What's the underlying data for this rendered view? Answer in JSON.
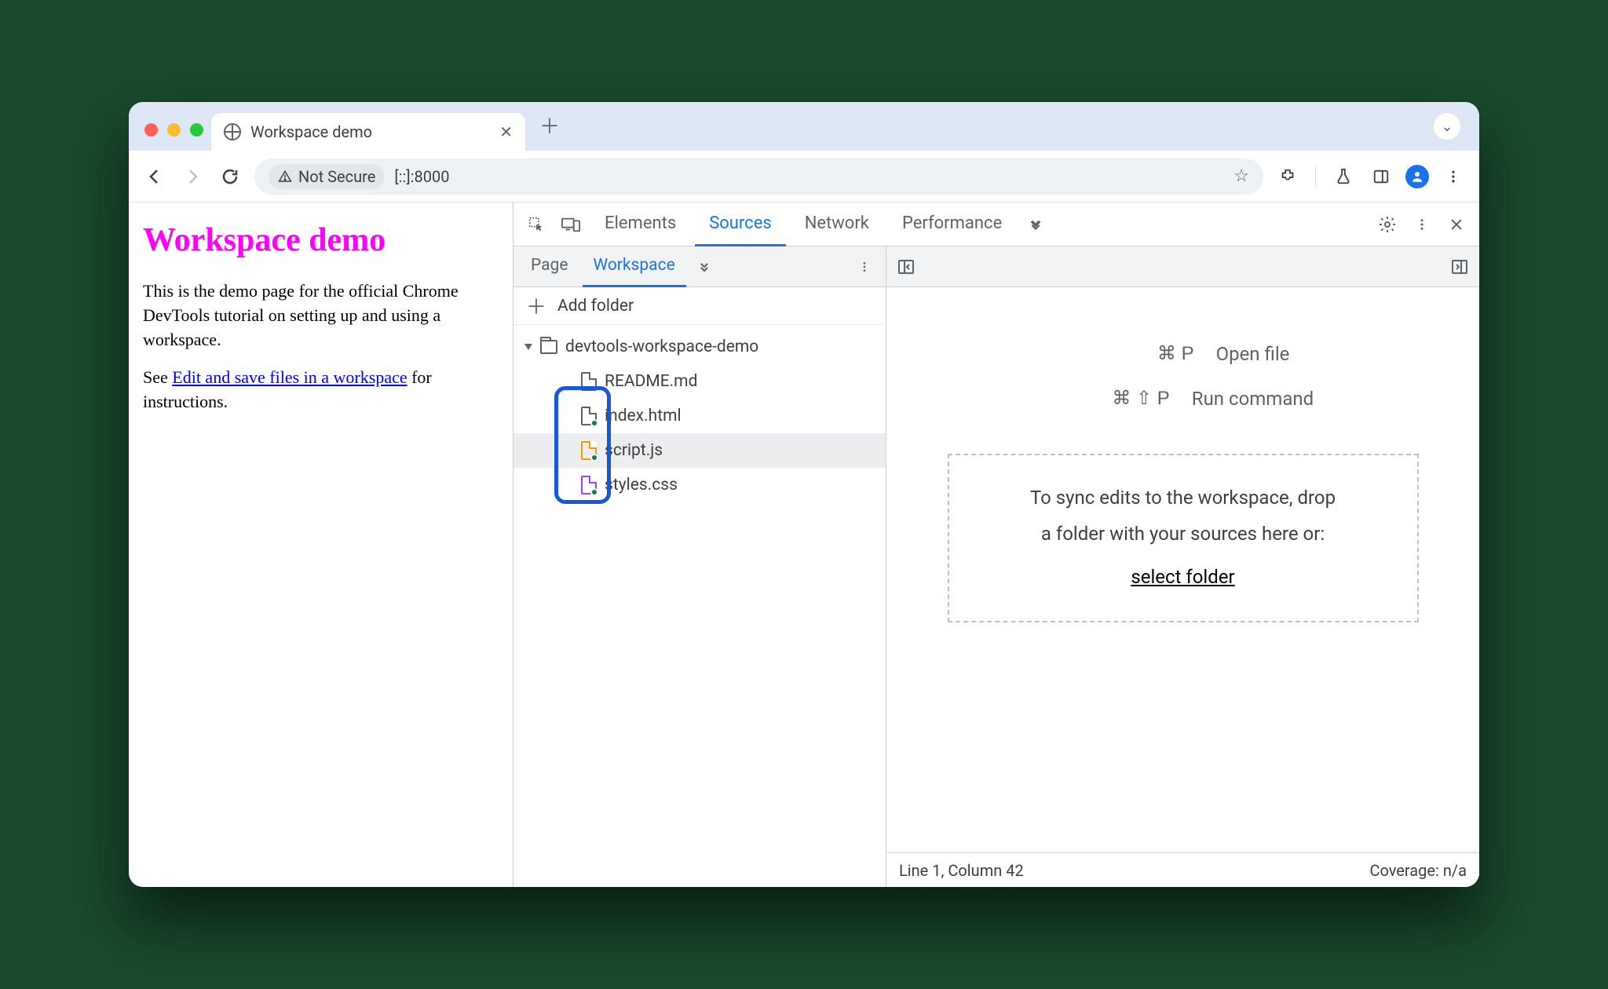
{
  "browser": {
    "tab_title": "Workspace demo",
    "not_secure": "Not Secure",
    "url": "[::]:8000"
  },
  "page": {
    "heading": "Workspace demo",
    "paragraph": "This is the demo page for the official Chrome DevTools tutorial on setting up and using a workspace.",
    "see_prefix": "See ",
    "link_text": "Edit and save files in a workspace",
    "see_suffix": " for instructions."
  },
  "devtools": {
    "tabs": [
      "Elements",
      "Sources",
      "Network",
      "Performance"
    ],
    "active_tab": "Sources",
    "sources": {
      "subtabs": [
        "Page",
        "Workspace"
      ],
      "active_subtab": "Workspace",
      "add_folder": "Add folder",
      "folder": "devtools-workspace-demo",
      "files": [
        {
          "name": "README.md",
          "color": "#5f6368",
          "mapped": false
        },
        {
          "name": "index.html",
          "color": "#5f6368",
          "mapped": true
        },
        {
          "name": "script.js",
          "color": "#f29900",
          "mapped": true
        },
        {
          "name": "styles.css",
          "color": "#a142f4",
          "mapped": true
        }
      ],
      "selected_file": "script.js",
      "shortcuts": [
        {
          "keys": "⌘ P",
          "label": "Open file"
        },
        {
          "keys": "⌘ ⇧ P",
          "label": "Run command"
        }
      ],
      "dropzone_line1": "To sync edits to the workspace, drop",
      "dropzone_line2": "a folder with your sources here or:",
      "dropzone_link": "select folder",
      "status_left": "Line 1, Column 42",
      "status_right": "Coverage: n/a"
    }
  }
}
